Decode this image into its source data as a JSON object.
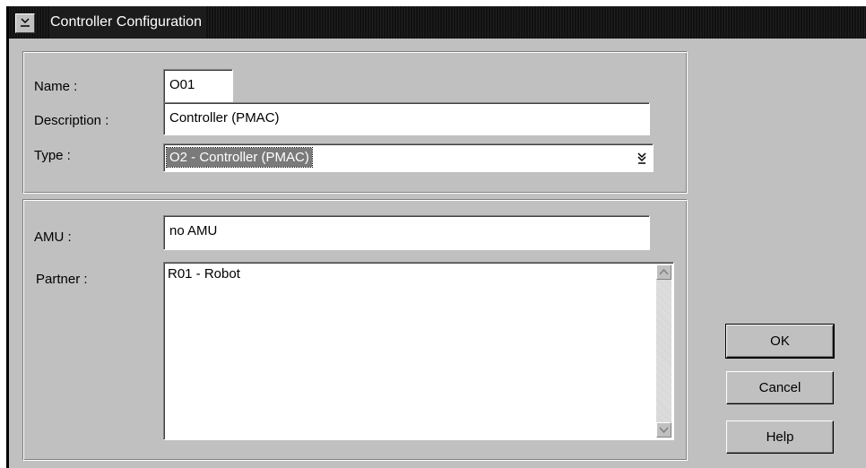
{
  "window": {
    "title": "Controller Configuration"
  },
  "general": {
    "name_label": "Name :",
    "name_value": "O01",
    "description_label": "Description :",
    "description_value": "Controller (PMAC)",
    "type_label": "Type :",
    "type_value": "O2 - Controller (PMAC)"
  },
  "links": {
    "amu_label": "AMU :",
    "amu_value": "no AMU",
    "partner_label": "Partner :",
    "partner_items": [
      "R01 - Robot"
    ]
  },
  "buttons": {
    "ok": "OK",
    "cancel": "Cancel",
    "help": "Help"
  },
  "icons": {
    "system_menu": "system-menu-icon",
    "dropdown": "chevron-down-icon",
    "scroll_up": "scroll-up-arrow-icon",
    "scroll_down": "scroll-down-arrow-icon"
  }
}
